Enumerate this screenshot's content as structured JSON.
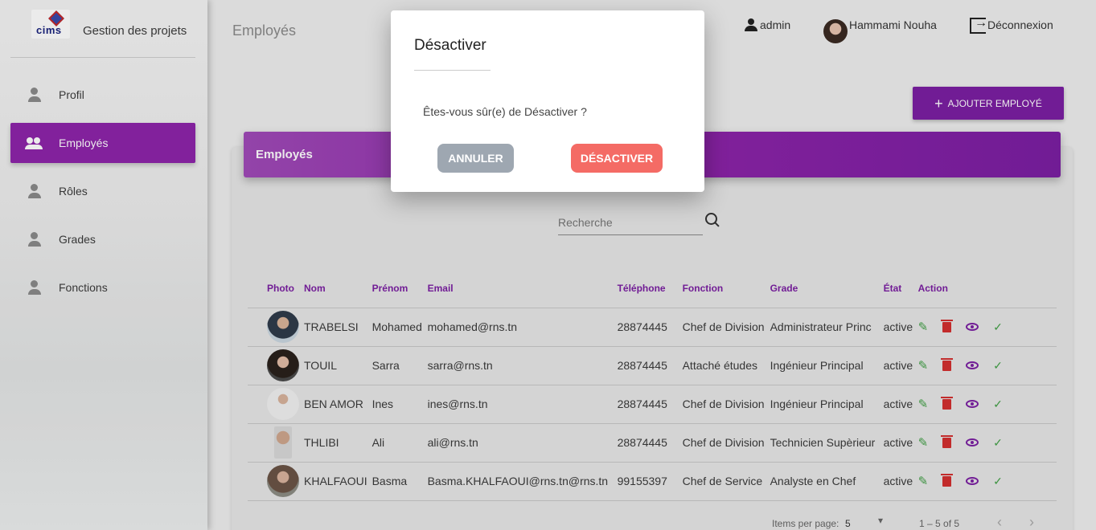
{
  "brand": {
    "logo_text": "cims",
    "title": "Gestion des projets"
  },
  "sidebar": {
    "items": [
      {
        "label": "Profil",
        "icon": "person-icon",
        "active": false
      },
      {
        "label": "Employés",
        "icon": "people-icon",
        "active": true
      },
      {
        "label": "Rôles",
        "icon": "person-icon",
        "active": false
      },
      {
        "label": "Grades",
        "icon": "person-icon",
        "active": false
      },
      {
        "label": "Fonctions",
        "icon": "person-icon",
        "active": false
      }
    ]
  },
  "header": {
    "page_title": "Employés",
    "role": "admin",
    "user_name": "Hammami Nouha",
    "logout": "Déconnexion"
  },
  "main": {
    "add_button": "AJOUTER EMPLOYÉ",
    "card_title": "Employés",
    "search_placeholder": "Recherche",
    "columns": [
      "Photo",
      "Nom",
      "Prénom",
      "Email",
      "Téléphone",
      "Fonction",
      "Grade",
      "État",
      "Action"
    ],
    "rows": [
      {
        "nom": "TRABELSI",
        "prenom": "Mohamed",
        "email": "mohamed@rns.tn",
        "tel": "28874445",
        "fonction": "Chef de Division",
        "grade": "Administrateur Princ",
        "etat": "active"
      },
      {
        "nom": "TOUIL",
        "prenom": "Sarra",
        "email": "sarra@rns.tn",
        "tel": "28874445",
        "fonction": "Attaché études",
        "grade": "Ingénieur Principal",
        "etat": "active"
      },
      {
        "nom": "BEN AMOR",
        "prenom": "Ines",
        "email": "ines@rns.tn",
        "tel": "28874445",
        "fonction": "Chef de Division",
        "grade": "Ingénieur Principal",
        "etat": "active"
      },
      {
        "nom": "THLIBI",
        "prenom": "Ali",
        "email": "ali@rns.tn",
        "tel": "28874445",
        "fonction": "Chef de Division",
        "grade": "Technicien Supèrieur",
        "etat": "active"
      },
      {
        "nom": "KHALFAOUI",
        "prenom": "Basma",
        "email": "Basma.KHALFAOUI@rns.tn@rns.tn",
        "tel": "99155397",
        "fonction": "Chef de Service",
        "grade": "Analyste en Chef",
        "etat": "active"
      }
    ],
    "pager": {
      "label": "Items per page:",
      "size": "5",
      "range": "1 – 5 of 5"
    }
  },
  "dialog": {
    "title": "Désactiver",
    "message": "Êtes-vous sûr(e) de Désactiver ?",
    "cancel": "ANNULER",
    "confirm": "DÉSACTIVER"
  },
  "colors": {
    "accent": "#8e24aa",
    "edit": "#43a047",
    "delete": "#d32f2f",
    "confirm": "#f46b65",
    "cancel": "#9ea7b1"
  }
}
